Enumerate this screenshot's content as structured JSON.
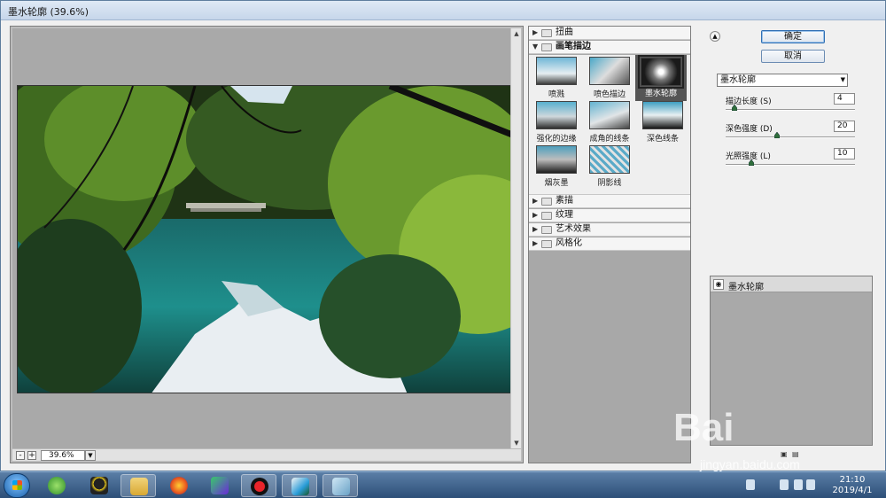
{
  "window": {
    "title": "墨水轮廓 (39.6%)"
  },
  "preview": {
    "zoom_value": "39.6%",
    "zoom_minus": "-",
    "zoom_plus": "+"
  },
  "gallery": {
    "categories_top": [
      {
        "label": "扭曲",
        "open": false
      },
      {
        "label": "画笔描边",
        "open": true
      }
    ],
    "thumbnails": [
      {
        "label": "喷溅",
        "selected": false
      },
      {
        "label": "喷色描边",
        "selected": false
      },
      {
        "label": "墨水轮廓",
        "selected": true
      },
      {
        "label": "强化的边缘",
        "selected": false
      },
      {
        "label": "成角的线条",
        "selected": false
      },
      {
        "label": "深色线条",
        "selected": false
      },
      {
        "label": "烟灰墨",
        "selected": false
      },
      {
        "label": "阴影线",
        "selected": false
      }
    ],
    "categories_bottom": [
      {
        "label": "素描"
      },
      {
        "label": "纹理"
      },
      {
        "label": "艺术效果"
      },
      {
        "label": "风格化"
      }
    ]
  },
  "panel": {
    "ok_label": "确定",
    "cancel_label": "取消",
    "filter_select": "墨水轮廓",
    "params": [
      {
        "label": "描边长度 (S)",
        "value": "4",
        "fraction": 0.07
      },
      {
        "label": "深色强度 (D)",
        "value": "20",
        "fraction": 0.4
      },
      {
        "label": "光照强度 (L)",
        "value": "10",
        "fraction": 0.2
      }
    ],
    "layer_name": "墨水轮廓"
  },
  "taskbar": {
    "time": "21:10",
    "date": "2019/4/1",
    "apps": [
      "browser-360",
      "qq",
      "file-explorer",
      "firefox",
      "video-player",
      "screen-recorder",
      "feather-app",
      "photoshop"
    ]
  },
  "watermark": {
    "brand": "Bai",
    "url": "jingyan.baidu.com"
  },
  "colors": {
    "titlebar": "#c6d6ea",
    "panel_bg": "#f0f0f0",
    "preview_bg": "#a9a9a9",
    "taskbar": "#2d4f78"
  }
}
